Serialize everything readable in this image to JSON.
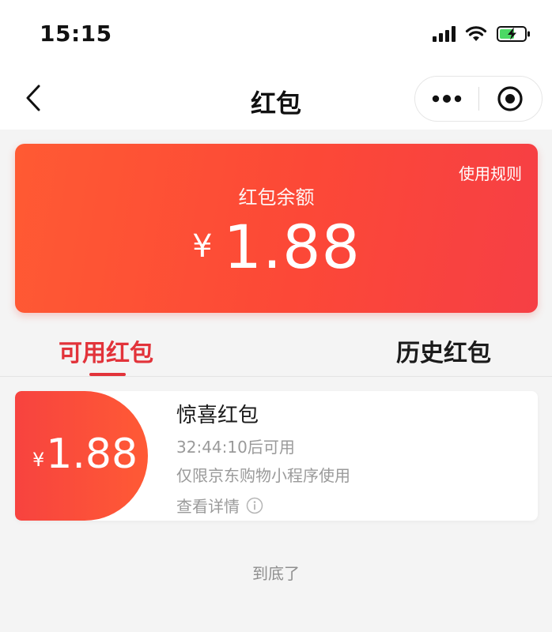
{
  "status_bar": {
    "time": "15:15",
    "icons": [
      "signal-icon",
      "wifi-icon",
      "battery-charging-icon"
    ]
  },
  "nav": {
    "title": "红包",
    "back_icon": "chevron-left-icon",
    "more_icon": "more-dots-icon",
    "close_icon": "target-circle-icon"
  },
  "balance_card": {
    "rules_link": "使用规则",
    "label": "红包余额",
    "currency": "¥",
    "amount": "1.88"
  },
  "tabs": [
    {
      "label": "可用红包",
      "active": true
    },
    {
      "label": "历史红包",
      "active": false
    }
  ],
  "coupons": [
    {
      "currency": "¥",
      "amount": "1.88",
      "name": "惊喜红包",
      "availability": "32:44:10后可用",
      "restriction": "仅限京东购物小程序使用",
      "details_label": "查看详情",
      "details_icon": "info-icon"
    }
  ],
  "footer": {
    "end_text": "到底了"
  },
  "colors": {
    "accent_red": "#e2333a",
    "card_gradient_start": "#ff5a33",
    "card_gradient_end": "#f63f45"
  }
}
